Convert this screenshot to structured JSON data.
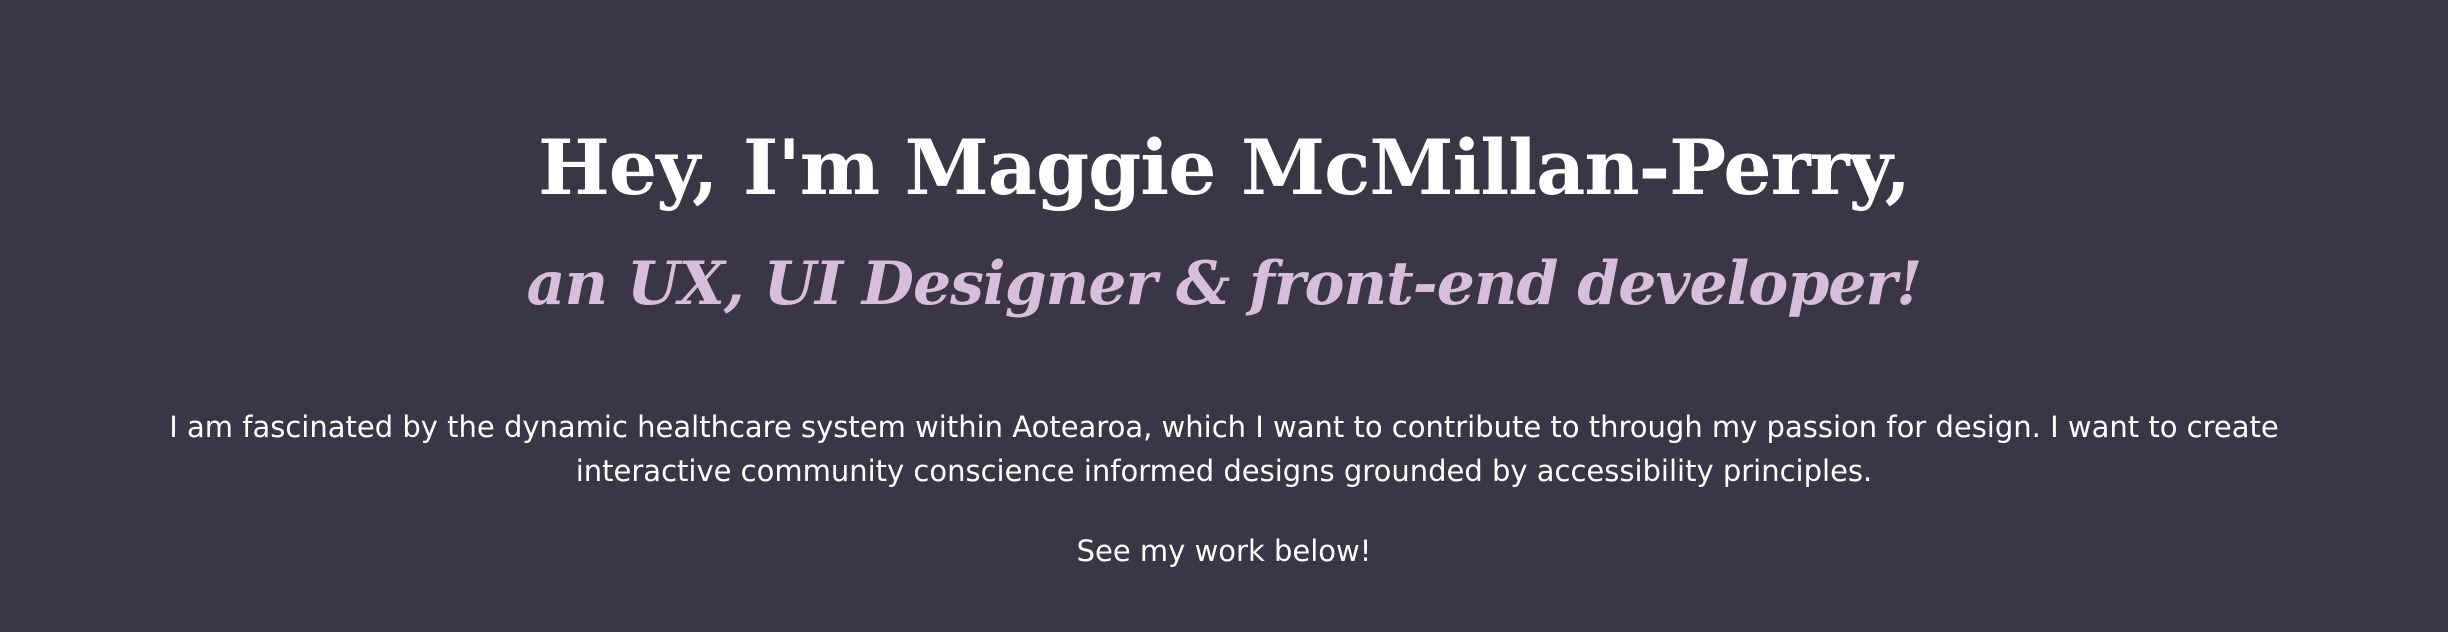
{
  "hero": {
    "title": "Hey, I'm Maggie McMillan-Perry,",
    "subtitle": "an UX, UI Designer & front-end developer!",
    "intro": "I am fascinated by the dynamic healthcare system within Aotearoa, which I want to contribute to through my passion for design. I want to create interactive community conscience informed designs grounded by accessibility principles.",
    "cta": "See my work below!"
  },
  "colors": {
    "background": "#3a3645",
    "heading": "#ffffff",
    "accent": "#d7bfdc",
    "body_text": "#ffffff"
  }
}
